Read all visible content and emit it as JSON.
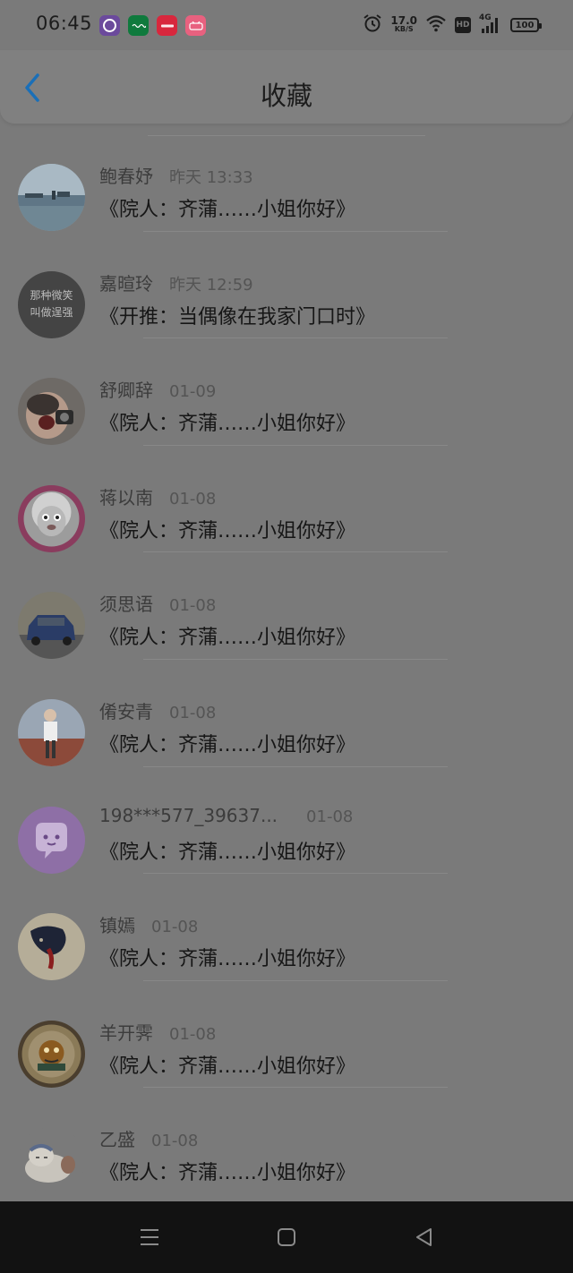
{
  "status_bar": {
    "time": "06:45",
    "apps": [
      "video-app-icon",
      "green-app-icon",
      "xiaohongshu-icon",
      "bilibili-icon"
    ],
    "network_speed": "17.0",
    "network_unit": "KB/S",
    "hd": "HD",
    "network_type": "4G",
    "battery": "100"
  },
  "header": {
    "title": "收藏",
    "back_icon": "chevron-left-icon"
  },
  "colors": {
    "accent": "#1a6fb8",
    "overlay": "#7a7a7a",
    "nav_bar": "#121212"
  },
  "items": [
    {
      "name": "鲍春妤",
      "date": "昨天 13:33",
      "title": "《院人：齐蒲……小姐你好》",
      "avatar": "harbor-landscape"
    },
    {
      "name": "嘉暄玲",
      "date": "昨天 12:59",
      "title": "《开推：当偶像在我家门口时》",
      "avatar": "text-calligraphy",
      "avatar_text_1": "那种微笑",
      "avatar_text_2": "叫做逞强"
    },
    {
      "name": "舒卿辞",
      "date": "01-09",
      "title": "《院人：齐蒲……小姐你好》",
      "avatar": "child-with-camera"
    },
    {
      "name": "蒋以南",
      "date": "01-08",
      "title": "《院人：齐蒲……小姐你好》",
      "avatar": "cartoon-sheep"
    },
    {
      "name": "须思语",
      "date": "01-08",
      "title": "《院人：齐蒲……小姐你好》",
      "avatar": "blue-car"
    },
    {
      "name": "倄安青",
      "date": "01-08",
      "title": "《院人：齐蒲……小姐你好》",
      "avatar": "person-on-wall"
    },
    {
      "name": "198***577_39637...",
      "date": "01-08",
      "title": "《院人：齐蒲……小姐你好》",
      "avatar": "chat-bubble"
    },
    {
      "name": "镇嫣",
      "date": "01-08",
      "title": "《院人：齐蒲……小姐你好》",
      "avatar": "ink-illustration"
    },
    {
      "name": "羊开霁",
      "date": "01-08",
      "title": "《院人：齐蒲……小姐你好》",
      "avatar": "cartoon-plate"
    },
    {
      "name": "乙盛",
      "date": "01-08",
      "title": "《院人：齐蒲……小姐你好》",
      "avatar": "cartoon-sleeping"
    }
  ],
  "nav_bar": {
    "buttons": [
      "menu-icon",
      "home-icon",
      "back-triangle-icon"
    ]
  }
}
